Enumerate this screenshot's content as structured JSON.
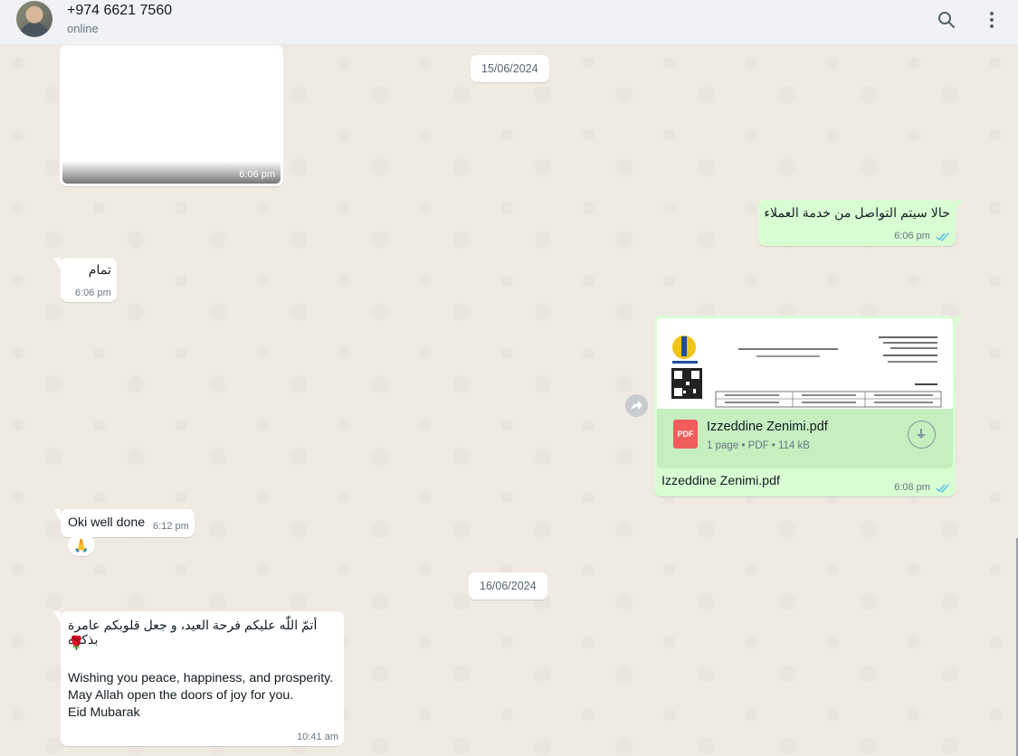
{
  "header": {
    "contact_name": "+974 6621 7560",
    "status": "online"
  },
  "dates": [
    "15/06/2024",
    "16/06/2024"
  ],
  "messages": {
    "image": {
      "time": "6:06 pm"
    },
    "out1": {
      "text": "حالا سيتم التواصل من خدمة العملاء",
      "time": "6:06 pm"
    },
    "in1": {
      "text": "تمام",
      "time": "6:06 pm"
    },
    "pdf": {
      "file_name": "Izzeddine Zenimi.pdf",
      "meta": "1 page • PDF • 114 kB",
      "badge": "PDF",
      "caption": "Izzeddine Zenimi.pdf",
      "time": "6:08 pm"
    },
    "in2": {
      "text": "Oki well done",
      "emoji": "🙏",
      "time": "6:12 pm"
    },
    "in3": {
      "arabic": "أتمّ اللّٰه عليكم فرحة العيد، و جعل قلوبكم عامرة بذكره",
      "emoji": "🌹",
      "line1": "Wishing you peace, happiness, and prosperity.",
      "line2": "May Allah open the doors of joy for you.",
      "line3": "Eid Mubarak",
      "time": "10:41 am"
    }
  },
  "colors": {
    "incoming_bubble": "#ffffff",
    "outgoing_bubble": "#d9fdd3",
    "read_ticks": "#53bdeb",
    "pdf_badge": "#f15c5c",
    "chat_background": "#efeae2"
  }
}
